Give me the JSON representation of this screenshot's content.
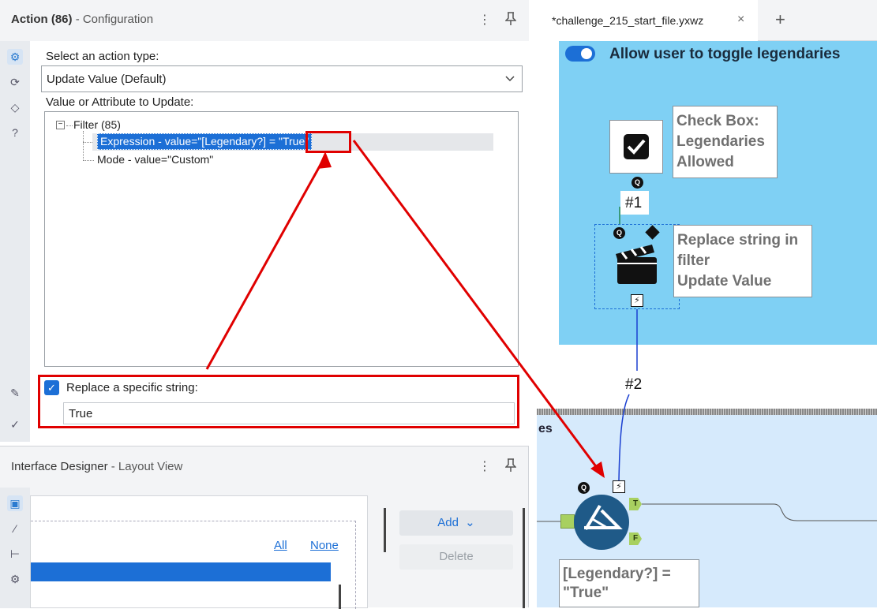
{
  "config_panel": {
    "title": "Action (86)",
    "subtitle": "- Configuration",
    "header_icons": [
      "more-vertical-icon",
      "pin-icon"
    ],
    "select_label": "Select an action type:",
    "action_type_value": "Update Value (Default)",
    "value_label": "Value or Attribute to Update:",
    "tree": {
      "root": "Filter (85)",
      "items": [
        "Expression - value=\"[Legendary?] = \"True\"",
        "Mode - value=\"Custom\""
      ]
    },
    "replace_checkbox_label": "Replace a specific string:",
    "replace_checked": true,
    "replace_value": "True",
    "side_icons": [
      "gear-icon",
      "rotate-icon",
      "tag-icon",
      "help-icon",
      "pencil-icon",
      "check-circle-icon"
    ]
  },
  "designer_panel": {
    "title": "Interface Designer",
    "subtitle": "- Layout View",
    "link_all": "All",
    "link_none": "None",
    "add_button": "Add",
    "delete_button": "Delete",
    "side_icons": [
      "layout-icon",
      "wand-icon",
      "tree-icon",
      "gear-icon"
    ]
  },
  "canvas": {
    "tab_label": "*challenge_215_start_file.yxwz",
    "tab_close": "×",
    "tab_add": "+",
    "container_title": "Allow user to toggle legendaries",
    "checkbox_tool_annotation": [
      "Check Box:",
      "Legendaries",
      "Allowed"
    ],
    "action_tool_annotation": [
      "Replace string in",
      "filter",
      "Update Value"
    ],
    "connection_1": "#1",
    "connection_2": "#2",
    "lower_container_title": "es",
    "filter_annotation": [
      "[Legendary?] =",
      "\"True\""
    ],
    "port_true": "T",
    "port_false": "F",
    "q_badge": "Q",
    "bolt_glyph": "⚡"
  },
  "colors": {
    "accent_blue": "#1c6fd6",
    "highlight_red": "#e00000",
    "container_blue": "#7fd0f4",
    "lower_area": "#d6eafc",
    "filter_tool": "#1f5a88"
  }
}
